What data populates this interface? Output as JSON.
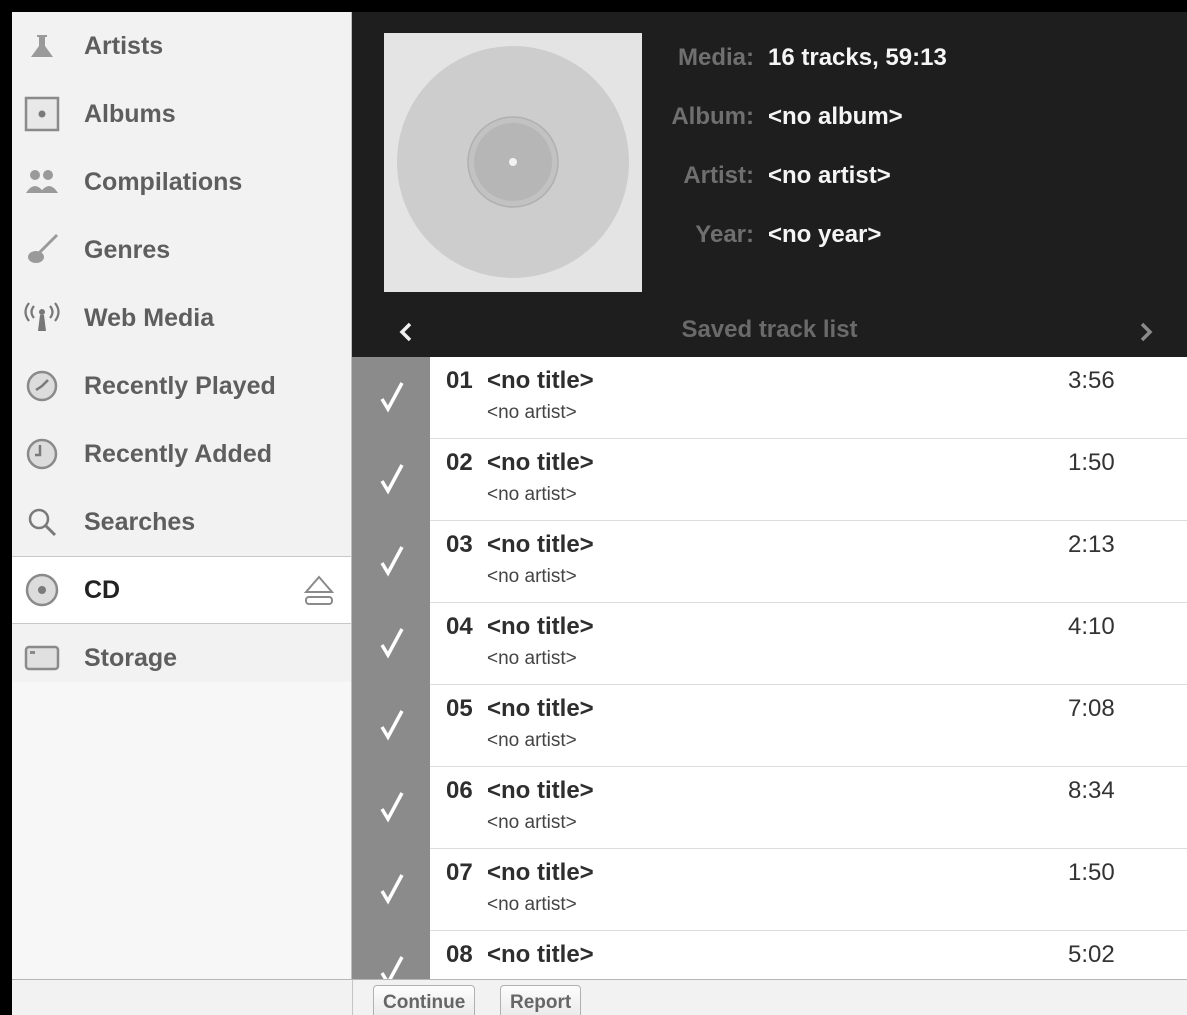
{
  "sidebar": {
    "items": [
      {
        "label": "Artists",
        "icon": "artist-icon"
      },
      {
        "label": "Albums",
        "icon": "album-icon"
      },
      {
        "label": "Compilations",
        "icon": "compilations-icon"
      },
      {
        "label": "Genres",
        "icon": "guitar-icon"
      },
      {
        "label": "Web Media",
        "icon": "antenna-icon"
      },
      {
        "label": "Recently Played",
        "icon": "clock-played-icon"
      },
      {
        "label": "Recently Added",
        "icon": "clock-added-icon"
      },
      {
        "label": "Searches",
        "icon": "search-icon"
      },
      {
        "label": "CD",
        "icon": "cd-icon",
        "active": true
      },
      {
        "label": "Storage",
        "icon": "storage-icon"
      }
    ]
  },
  "header": {
    "media_key": "Media:",
    "media_val": "16 tracks, 59:13",
    "album_key": "Album:",
    "album_val": "<no album>",
    "artist_key": "Artist:",
    "artist_val": "<no artist>",
    "year_key": "Year:",
    "year_val": "<no year>",
    "nav_title": "Saved track list"
  },
  "tracks": [
    {
      "num": "01",
      "title": "<no title>",
      "artist": "<no artist>",
      "duration": "3:56"
    },
    {
      "num": "02",
      "title": "<no title>",
      "artist": "<no artist>",
      "duration": "1:50"
    },
    {
      "num": "03",
      "title": "<no title>",
      "artist": "<no artist>",
      "duration": "2:13"
    },
    {
      "num": "04",
      "title": "<no title>",
      "artist": "<no artist>",
      "duration": "4:10"
    },
    {
      "num": "05",
      "title": "<no title>",
      "artist": "<no artist>",
      "duration": "7:08"
    },
    {
      "num": "06",
      "title": "<no title>",
      "artist": "<no artist>",
      "duration": "8:34"
    },
    {
      "num": "07",
      "title": "<no title>",
      "artist": "<no artist>",
      "duration": "1:50"
    },
    {
      "num": "08",
      "title": "<no title>",
      "artist": "",
      "duration": "5:02"
    }
  ],
  "bottom": {
    "continue_label": "Continue",
    "report_label": "Report"
  },
  "colors": {
    "header_bg": "#1e1e1e",
    "check_column": "#8b8b8b",
    "sidebar_bg": "#f2f2f2"
  }
}
